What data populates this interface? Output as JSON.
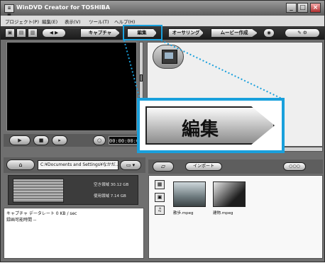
{
  "window": {
    "title": "WinDVD Creator for TOSHIBA",
    "app_icon_text": "≡ ■",
    "controls": {
      "minimize": "_",
      "maximize": "□",
      "close": "×"
    }
  },
  "menu": {
    "items": [
      "プロジェクト(P)",
      "編集(E)",
      "表示(V)",
      "ツール(T)",
      "ヘルプ(H)"
    ]
  },
  "toolbar": {
    "capture": "キャプチャ",
    "edit": "編集",
    "authoring": "オーサリング",
    "make_movie": "ムービー作成"
  },
  "player": {
    "timecode": "00:00:00:00",
    "play_symbol": "▶"
  },
  "zoom_callout": {
    "label": "編集",
    "accent_color": "#19a0dc"
  },
  "capture_panel": {
    "path": "C:¥Documents and Settings¥なかだ...",
    "free_space": "空き領域 30.12 GB",
    "used_space": "使用領域 7.14 GB",
    "capture_rate": "キャプチャ データレート 0 KB / sec",
    "record_time": "録画可能時間 --"
  },
  "library": {
    "import_button": "インポート",
    "size_button": "○○○",
    "items": [
      {
        "label": "散歩.mpeg"
      },
      {
        "label": "建物.mpeg"
      }
    ]
  }
}
